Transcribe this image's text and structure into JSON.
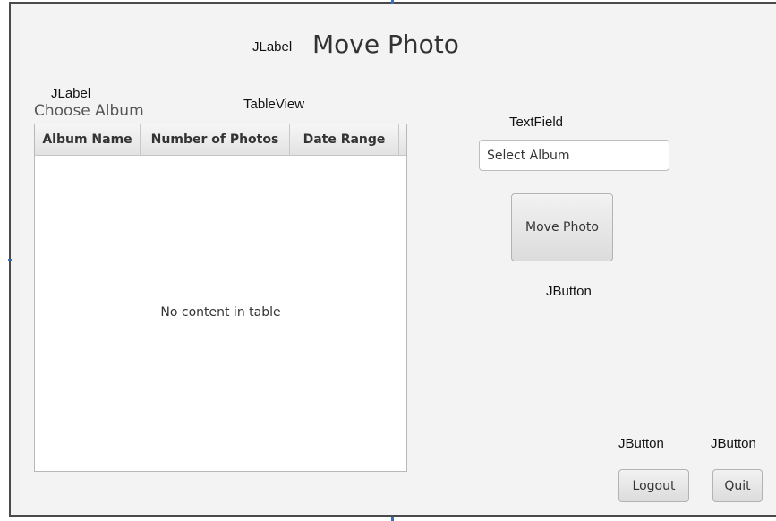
{
  "annotations": {
    "title_jlabel": "JLabel",
    "choose_jlabel": "JLabel",
    "tableview": "TableView",
    "textfield": "TextField",
    "move_jbutton": "JButton",
    "logout_jbutton": "JButton",
    "quit_jbutton": "JButton"
  },
  "title": "Move Photo",
  "choose_album_label": "Choose Album",
  "table": {
    "columns": [
      "Album Name",
      "Number of Photos",
      "Date Range"
    ],
    "empty_message": "No content in table"
  },
  "select_album": {
    "placeholder": "Select Album",
    "value": ""
  },
  "buttons": {
    "move_photo": "Move Photo",
    "logout": "Logout",
    "quit": "Quit"
  }
}
